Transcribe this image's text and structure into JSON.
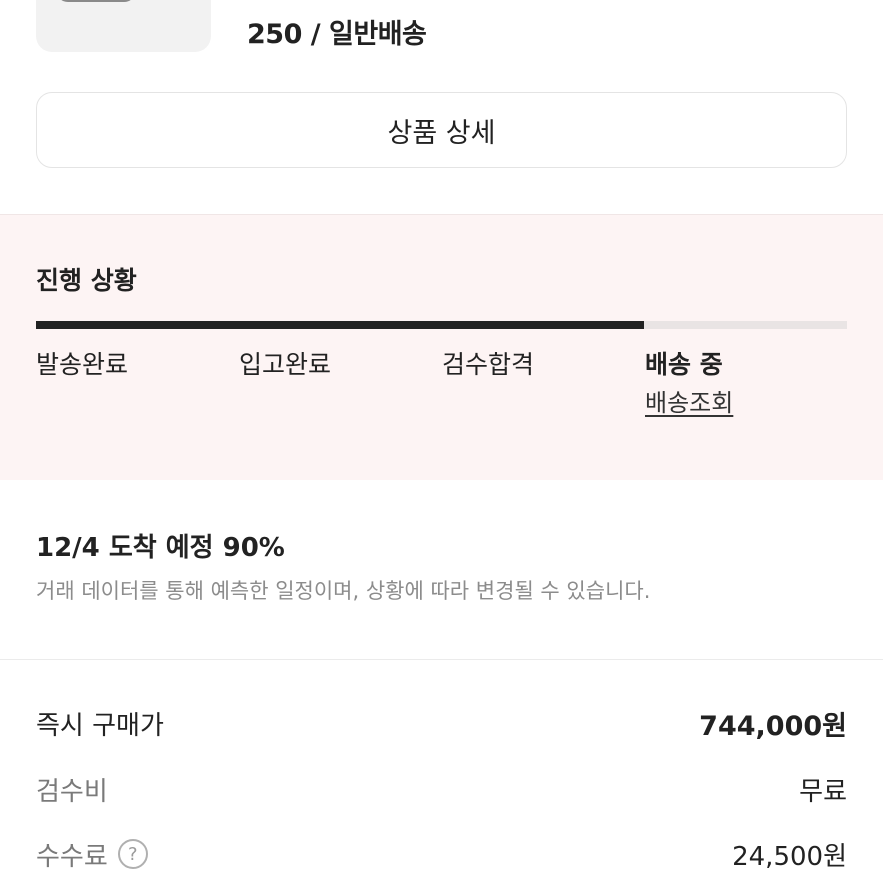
{
  "product": {
    "option_text": "250 / 일반배송"
  },
  "detail_button": {
    "label": "상품 상세"
  },
  "progress": {
    "title": "진행 상황",
    "fill_fraction": 0.75,
    "steps": [
      "발송완료",
      "입고완료",
      "검수합격",
      "배송 중"
    ],
    "active_step": 3,
    "tracking_link": "배송조회"
  },
  "eta": {
    "title": "12/4 도착 예정 90%",
    "description": "거래 데이터를 통해 예측한 일정이며, 상황에 따라 변경될 수 있습니다."
  },
  "prices": {
    "instant_buy_label": "즉시 구매가",
    "instant_buy_value": "744,000원",
    "inspection_label": "검수비",
    "inspection_value": "무료",
    "fee_label": "수수료",
    "fee_help": "?",
    "fee_value": "24,500원"
  },
  "colors": {
    "progress_bg": "#fdf4f4",
    "progress_fill": "#222222",
    "progress_track": "#e9e4e4"
  },
  "icons": {
    "help": "question-circle-icon"
  }
}
